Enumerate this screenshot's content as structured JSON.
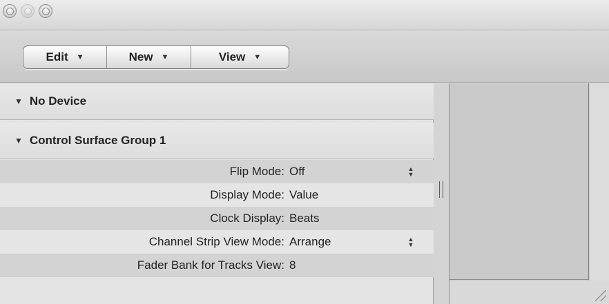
{
  "toolbar": {
    "menus": [
      {
        "label": "Edit"
      },
      {
        "label": "New"
      },
      {
        "label": "View"
      }
    ]
  },
  "inspector": {
    "groups": [
      {
        "label": "No Device"
      },
      {
        "label": "Control Surface Group 1"
      }
    ],
    "rows": [
      {
        "label": "Flip Mode:",
        "value": "Off"
      },
      {
        "label": "Display Mode:",
        "value": "Value"
      },
      {
        "label": "Clock Display:",
        "value": "Beats"
      },
      {
        "label": "Channel Strip View Mode:",
        "value": "Arrange"
      },
      {
        "label": "Fader Bank for Tracks View:",
        "value": "8"
      }
    ]
  },
  "icons": {
    "disclosure": "disclosure-triangle-icon",
    "popup": "popup-arrow-icon",
    "stepper": "up-down-stepper-icon",
    "splitter": "splitter-grip-icon",
    "resize": "resize-grip-icon"
  }
}
